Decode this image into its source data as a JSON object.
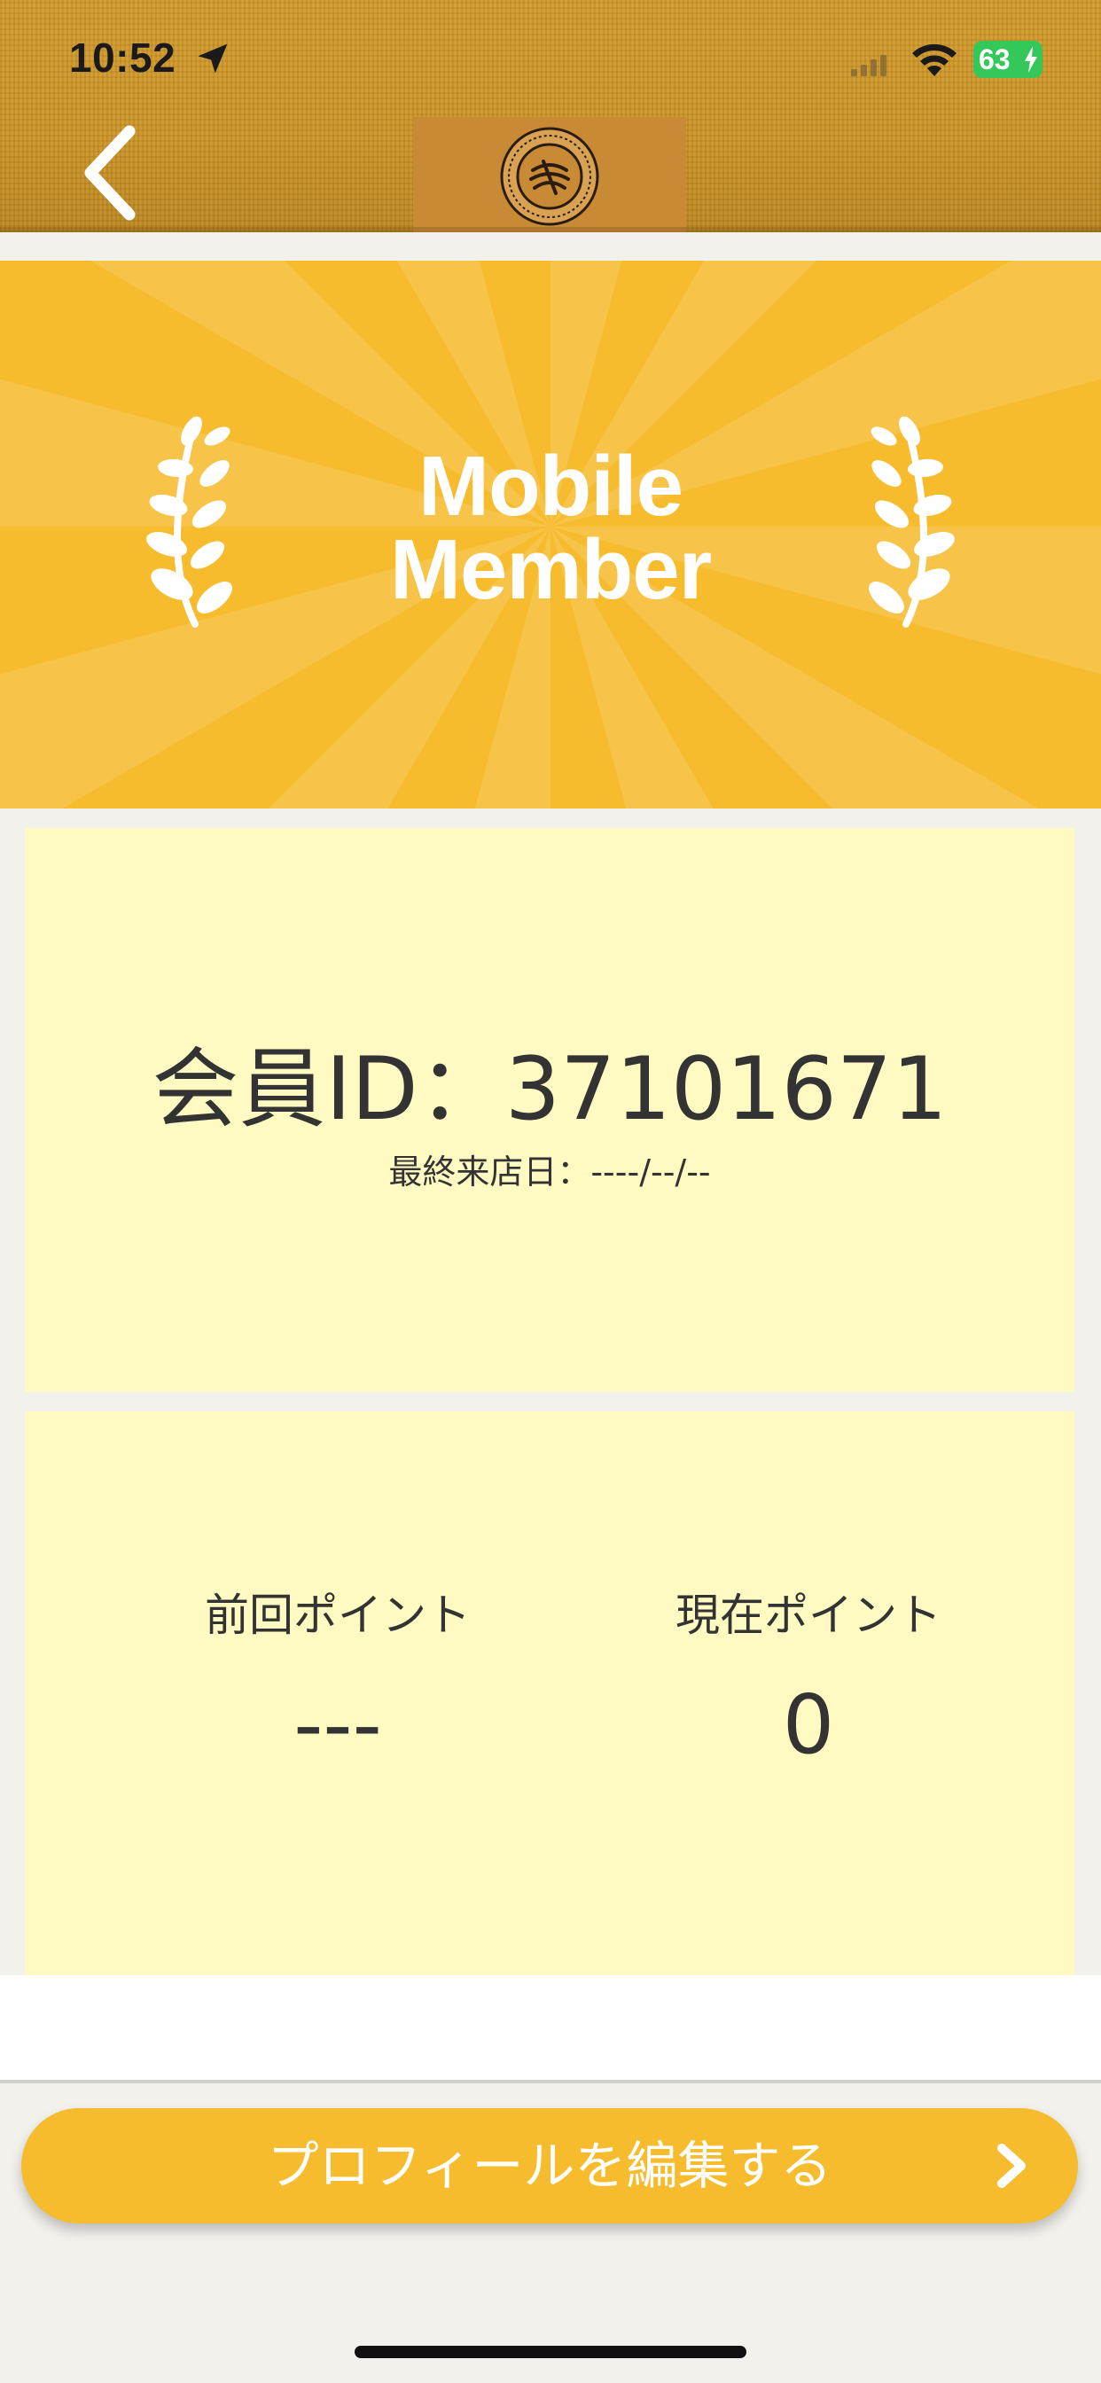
{
  "status_bar": {
    "time": "10:52",
    "battery": "63"
  },
  "nav": {
    "back_icon": "chevron-left-icon",
    "logo_icon": "brand-emblem"
  },
  "banner": {
    "line1": "Mobile",
    "line2": "Member",
    "decoration_icon": "laurel-icon",
    "color": "#f6bc2e"
  },
  "member": {
    "id_text": "会員ID：37101671",
    "last_visit": "最終来店日：----/--/--"
  },
  "points": {
    "previous_label": "前回ポイント",
    "previous_value": "---",
    "current_label": "現在ポイント",
    "current_value": "0"
  },
  "actions": {
    "edit_profile": "プロフィールを編集する",
    "edit_profile_icon": "chevron-right-icon"
  },
  "colors": {
    "accent": "#f6bc2e",
    "card": "#fffac2",
    "header": "#c9922a"
  }
}
